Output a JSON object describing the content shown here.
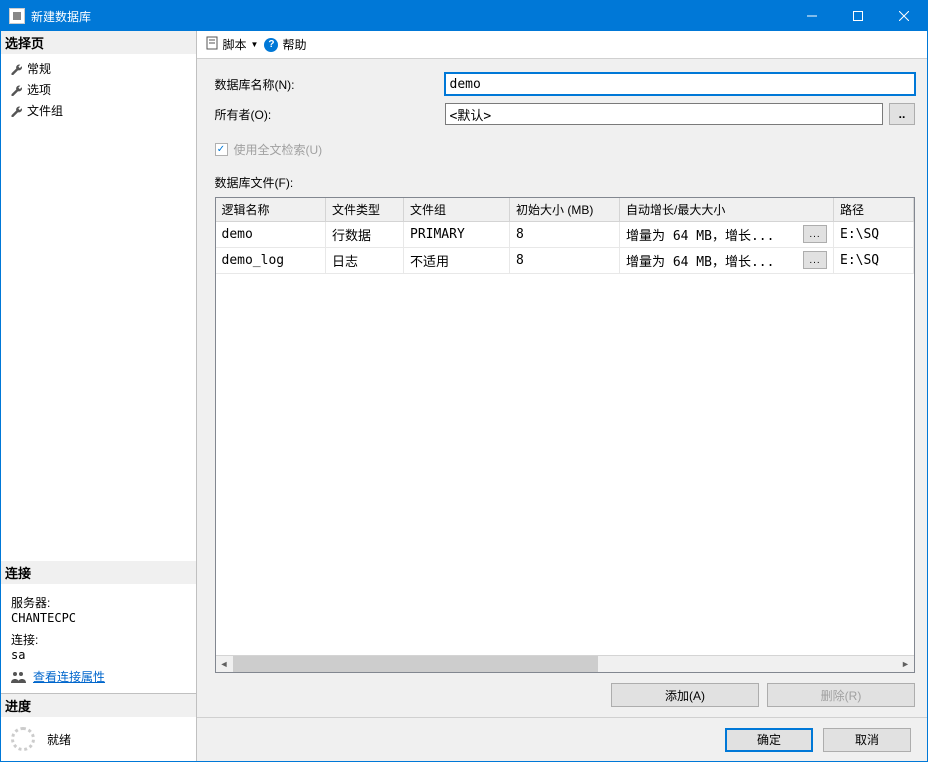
{
  "window": {
    "title": "新建数据库"
  },
  "sidebar": {
    "select_header": "选择页",
    "pages": [
      "常规",
      "选项",
      "文件组"
    ],
    "conn_header": "连接",
    "server_label": "服务器:",
    "server_value": "CHANTECPC",
    "conn_label": "连接:",
    "conn_value": "sa",
    "view_props": "查看连接属性",
    "progress_header": "进度",
    "progress_status": "就绪"
  },
  "toolbar": {
    "script": "脚本",
    "help": "帮助"
  },
  "form": {
    "dbname_label": "数据库名称(N):",
    "dbname_value": "demo",
    "owner_label": "所有者(O):",
    "owner_value": "<默认>",
    "fulltext_label": "使用全文检索(U)",
    "files_label": "数据库文件(F):"
  },
  "table": {
    "headers": [
      "逻辑名称",
      "文件类型",
      "文件组",
      "初始大小 (MB)",
      "自动增长/最大大小",
      "路径"
    ],
    "rows": [
      {
        "name": "demo",
        "type": "行数据",
        "group": "PRIMARY",
        "size": "8",
        "growth": "增量为 64 MB，增长...",
        "path": "E:\\SQ"
      },
      {
        "name": "demo_log",
        "type": "日志",
        "group": "不适用",
        "size": "8",
        "growth": "增量为 64 MB，增长...",
        "path": "E:\\SQ"
      }
    ]
  },
  "buttons": {
    "add": "添加(A)",
    "remove": "删除(R)",
    "ok": "确定",
    "cancel": "取消"
  }
}
